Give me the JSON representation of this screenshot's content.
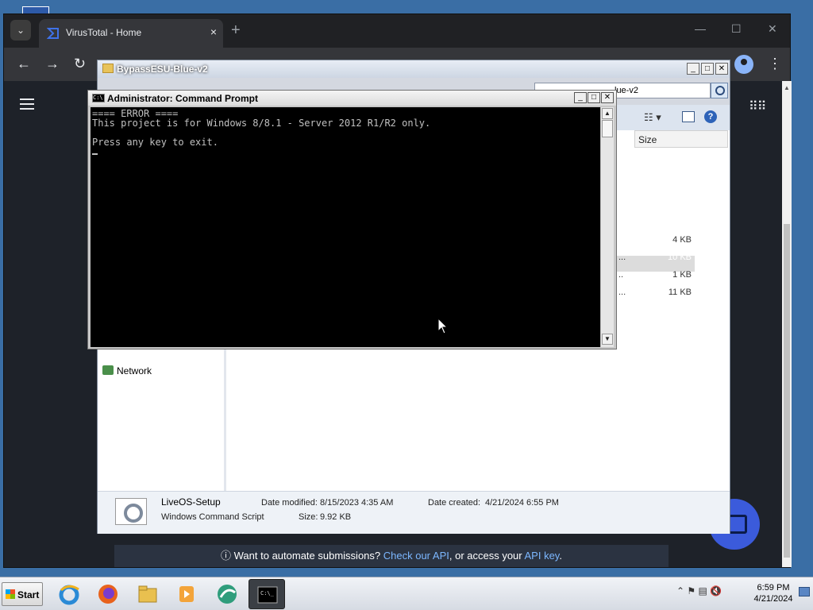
{
  "browser": {
    "tab_title": "VirusTotal - Home",
    "tab_close": "×",
    "new_tab": "+",
    "banner": {
      "info_icon": "info-icon",
      "prefix": "Want to automate submissions? ",
      "link1": "Check our API",
      "middle": ", or access your ",
      "link2": "API key",
      "suffix": ".",
      "info_glyph": "ⓘ"
    }
  },
  "explorer": {
    "title": "BypassESU-Blue-v2",
    "address_text": "lue-v2",
    "column_size": "Size",
    "rows": [
      {
        "name_tail": "",
        "size": "4 KB"
      },
      {
        "name_tail": "...",
        "size": "10 KB"
      },
      {
        "name_tail": "..",
        "size": "1 KB"
      },
      {
        "name_tail": "...",
        "size": "11 KB"
      }
    ],
    "nav_network": "Network",
    "details": {
      "name": "LiveOS-Setup",
      "type": "Windows Command Script",
      "modified_label": "Date modified:",
      "modified_value": "8/15/2023 4:35 AM",
      "created_label": "Date created:",
      "created_value": "4/21/2024 6:55 PM",
      "size_label": "Size:",
      "size_value": "9.92 KB"
    }
  },
  "cmd": {
    "title": "Administrator:  Command Prompt",
    "lines": [
      "==== ERROR ====",
      "This project is for Windows 8/8.1 - Server 2012 R1/R2 only.",
      "",
      "Press any key to exit."
    ]
  },
  "taskbar": {
    "start_label": "Start",
    "time": "6:59 PM",
    "date": "4/21/2024",
    "apps": [
      "internet-explorer-icon",
      "firefox-icon",
      "file-explorer-icon",
      "media-player-icon",
      "app-icon",
      "command-prompt-icon"
    ]
  },
  "colors": {
    "desktop": "#3a6ea5",
    "browser_frame": "#202124",
    "link": "#7cb7ff",
    "console_bg": "#000000",
    "console_fg": "#c0c0c0"
  }
}
